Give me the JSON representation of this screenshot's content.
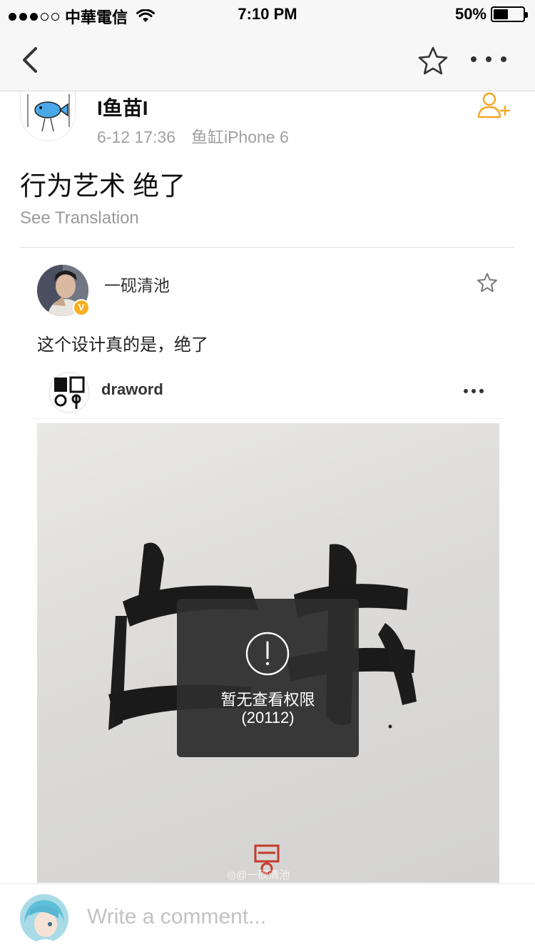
{
  "status_bar": {
    "carrier": "中華電信",
    "time": "7:10 PM",
    "battery_percent": "50%",
    "battery_level": 0.5,
    "signal_bars_filled": 3,
    "signal_bars_total": 5
  },
  "nav": {
    "back_icon": "chevron-left-icon",
    "favorite_icon": "star-outline-icon",
    "more_icon": "more-horizontal-icon"
  },
  "post": {
    "author": "I鱼苗I",
    "time": "6-12 17:36",
    "source": "鱼缸iPhone 6",
    "text": "行为艺术 绝了",
    "translate_label": "See Translation",
    "follow_icon": "add-user-icon",
    "accent_color": "#f5a623"
  },
  "shared": {
    "author": "一砚清池",
    "verified": true,
    "text": "这个设计真的是，绝了",
    "embed": {
      "account": "draword",
      "more_icon": "more-horizontal-icon"
    },
    "permission": {
      "message": "暂无查看权限",
      "code": "(20112)"
    }
  },
  "comment": {
    "placeholder": "Write a comment..."
  }
}
